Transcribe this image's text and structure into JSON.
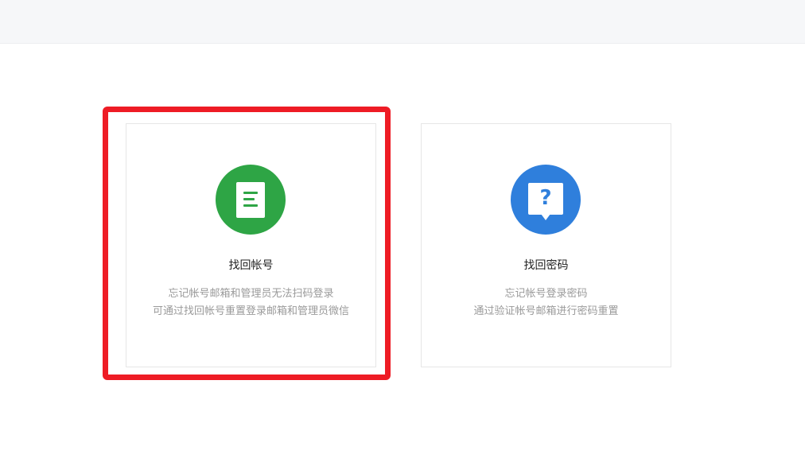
{
  "cards": [
    {
      "icon": "document-icon",
      "title": "找回帐号",
      "desc_line1": "忘记帐号邮箱和管理员无法扫码登录",
      "desc_line2": "可通过找回帐号重置登录邮箱和管理员微信",
      "color": "#2ea545"
    },
    {
      "icon": "help-question-icon",
      "title": "找回密码",
      "desc_line1": "忘记帐号登录密码",
      "desc_line2": "通过验证帐号邮箱进行密码重置",
      "color": "#2f7fdc",
      "qmark": "?"
    }
  ],
  "highlight_color": "#ee1c25"
}
